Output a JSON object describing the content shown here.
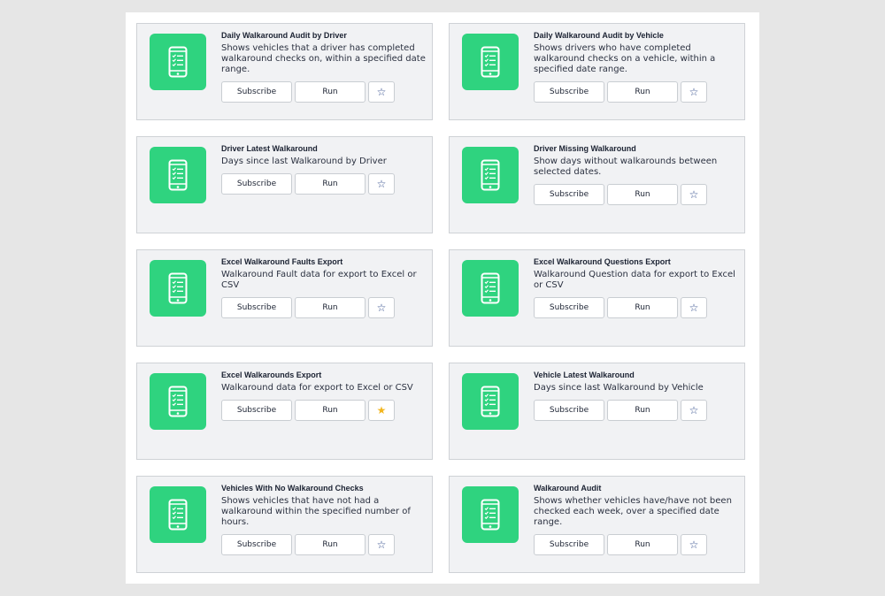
{
  "buttons": {
    "subscribe": "Subscribe",
    "run": "Run"
  },
  "icons": {
    "report": "phone-checklist-icon",
    "star": "star-icon"
  },
  "colors": {
    "icon_tile": "#2fd37f",
    "star_active": "#f2b51d",
    "star_inactive": "#2f4a8a"
  },
  "cards": [
    {
      "title": "Daily Walkaround Audit by Driver",
      "description": "Shows vehicles that a driver has completed walkaround checks on, within a specified date range.",
      "favorite": false
    },
    {
      "title": "Daily Walkaround Audit by Vehicle",
      "description": "Shows drivers who have completed walkaround checks on a vehicle, within a specified date range.",
      "favorite": false
    },
    {
      "title": "Driver Latest Walkaround",
      "description": "Days since last Walkaround by Driver",
      "favorite": false
    },
    {
      "title": "Driver Missing Walkaround",
      "description": "Show days without walkarounds between selected dates.",
      "favorite": false
    },
    {
      "title": "Excel Walkaround Faults Export",
      "description": "Walkaround Fault data for export to Excel or CSV",
      "favorite": false
    },
    {
      "title": "Excel Walkaround Questions Export",
      "description": "Walkaround Question data for export to Excel or CSV",
      "favorite": false
    },
    {
      "title": "Excel Walkarounds Export",
      "description": "Walkaround data for export to Excel or CSV",
      "favorite": true
    },
    {
      "title": "Vehicle Latest Walkaround",
      "description": "Days since last Walkaround by Vehicle",
      "favorite": false
    },
    {
      "title": "Vehicles With No Walkaround Checks",
      "description": "Shows vehicles that have not had a walkaround within the specified number of hours.",
      "favorite": false
    },
    {
      "title": "Walkaround Audit",
      "description": "Shows whether vehicles have/have not been checked each week, over a specified date range.",
      "favorite": false
    }
  ]
}
